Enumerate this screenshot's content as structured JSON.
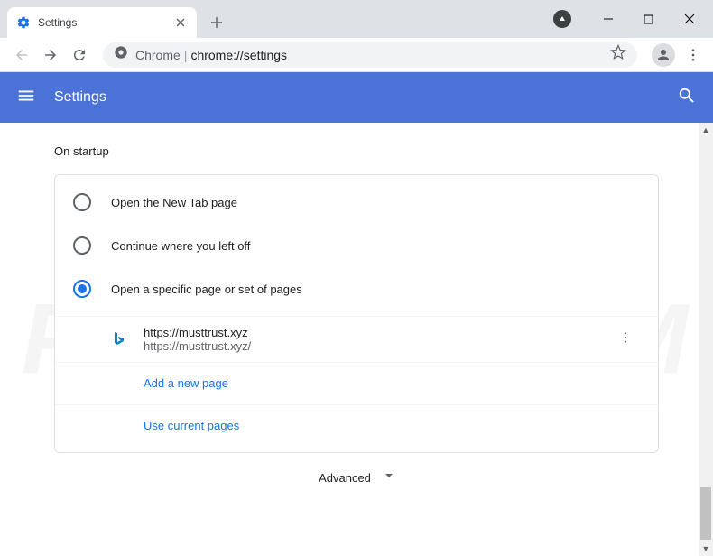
{
  "tab": {
    "title": "Settings"
  },
  "omnibox": {
    "prefix": "Chrome",
    "url": "chrome://settings"
  },
  "header": {
    "title": "Settings"
  },
  "section": {
    "title": "On startup"
  },
  "startup": {
    "options": [
      {
        "label": "Open the New Tab page"
      },
      {
        "label": "Continue where you left off"
      },
      {
        "label": "Open a specific page or set of pages"
      }
    ],
    "selected_index": 2,
    "pages": [
      {
        "title": "https://musttrust.xyz",
        "url": "https://musttrust.xyz/"
      }
    ],
    "add_page_label": "Add a new page",
    "use_current_label": "Use current pages"
  },
  "advanced": {
    "label": "Advanced"
  },
  "watermark": {
    "text": "PCRISK.COM"
  }
}
